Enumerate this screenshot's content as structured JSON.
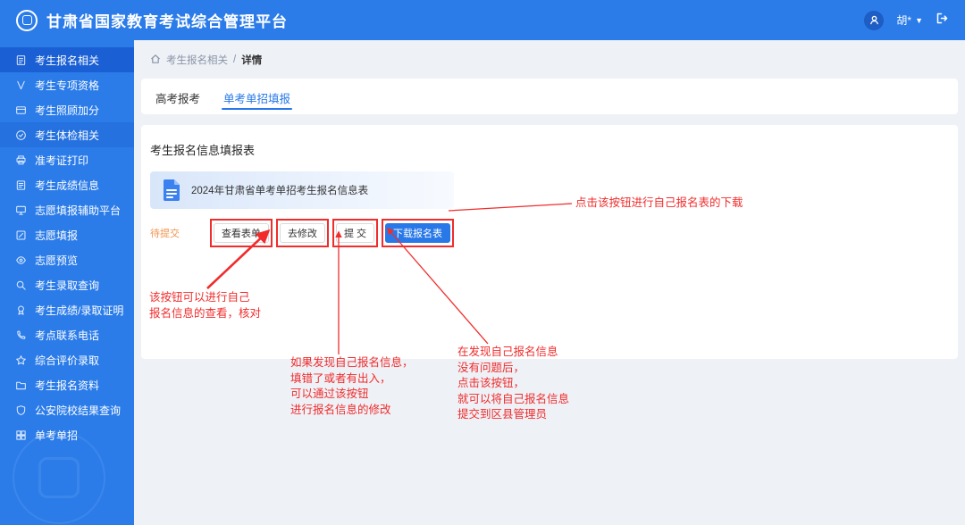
{
  "app": {
    "title": "甘肃省国家教育考试综合管理平台"
  },
  "header": {
    "user_name": "胡*",
    "caret": "▼"
  },
  "sidebar": {
    "items": [
      {
        "label": "考生报名相关",
        "icon": "registration-doc",
        "state": "active"
      },
      {
        "label": "考生专项资格",
        "icon": "qualification-v",
        "state": "normal"
      },
      {
        "label": "考生照顾加分",
        "icon": "bonus-card",
        "state": "normal"
      },
      {
        "label": "考生体检相关",
        "icon": "medical-check",
        "state": "dim"
      },
      {
        "label": "准考证打印",
        "icon": "print-ticket",
        "state": "normal"
      },
      {
        "label": "考生成绩信息",
        "icon": "score-list",
        "state": "normal"
      },
      {
        "label": "志愿填报辅助平台",
        "icon": "assist-platform",
        "state": "normal"
      },
      {
        "label": "志愿填报",
        "icon": "volunteer-edit",
        "state": "normal"
      },
      {
        "label": "志愿预览",
        "icon": "volunteer-preview",
        "state": "normal"
      },
      {
        "label": "考生录取查询",
        "icon": "admission-search",
        "state": "normal"
      },
      {
        "label": "考生成绩/录取证明",
        "icon": "certificate",
        "state": "normal"
      },
      {
        "label": "考点联系电话",
        "icon": "contact-phone",
        "state": "normal"
      },
      {
        "label": "综合评价录取",
        "icon": "evaluation-star",
        "state": "normal"
      },
      {
        "label": "考生报名资料",
        "icon": "material-folder",
        "state": "normal"
      },
      {
        "label": "公安院校结果查询",
        "icon": "police-shield",
        "state": "normal"
      },
      {
        "label": "单考单招",
        "icon": "single-exam-grid",
        "state": "normal"
      }
    ]
  },
  "breadcrumb": {
    "section": "考生报名相关",
    "separator": "/",
    "current": "详情"
  },
  "tabs": [
    {
      "label": "高考报考",
      "active": false
    },
    {
      "label": "单考单招填报",
      "active": true
    }
  ],
  "content": {
    "section_title": "考生报名信息填报表",
    "file_name": "2024年甘肃省单考单招考生报名信息表",
    "status": "待提交",
    "buttons": [
      {
        "label": "查看表单",
        "variant": "default",
        "name": "view-form-button"
      },
      {
        "label": "去修改",
        "variant": "default",
        "name": "modify-button"
      },
      {
        "label": "提 交",
        "variant": "default",
        "name": "submit-button"
      },
      {
        "label": "下载报名表",
        "variant": "primary",
        "name": "download-form-button"
      }
    ]
  },
  "annotations": {
    "download_note": [
      "点击该按钮进行自己报名表的下载"
    ],
    "view_note": [
      "该按钮可以进行自己",
      "报名信息的查看，核对"
    ],
    "modify_note": [
      "如果发现自己报名信息，",
      "填错了或者有出入，",
      "可以通过该按钮",
      "进行报名信息的修改"
    ],
    "submit_note": [
      "在发现自己报名信息",
      "没有问题后，",
      "点击该按钮，",
      "就可以将自己报名信息",
      "提交到区县管理员"
    ]
  },
  "colors": {
    "primary_blue": "#2878E8",
    "sidebar_blue": "#2B7CE9",
    "active_item_blue": "#1A5FD4",
    "annotation_red": "#F12C2C",
    "status_orange": "#F0944D",
    "page_bg": "#EEF1F6"
  }
}
